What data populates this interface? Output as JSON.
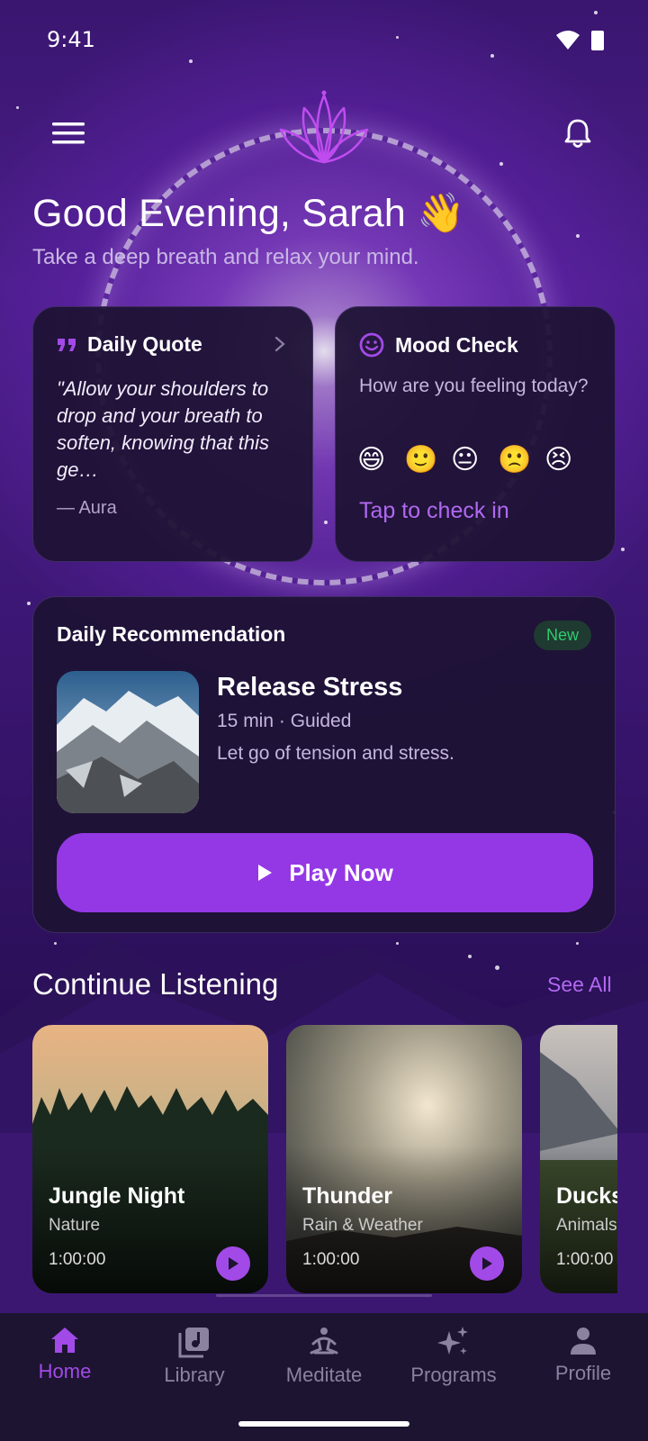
{
  "status_bar": {
    "time": "9:41"
  },
  "header": {
    "greeting": "Good Evening, Sarah 👋",
    "subtitle": "Take a deep breath and relax your mind."
  },
  "quote_card": {
    "title": "Daily Quote",
    "text": "\"Allow your shoulders to drop and your breath to soften, knowing that this ge…",
    "author": "— Aura"
  },
  "mood_card": {
    "title": "Mood Check",
    "question": "How are you feeling today?",
    "emojis": [
      "😄",
      "🙂",
      "😐",
      "🙁",
      "😣"
    ],
    "cta": "Tap to check in"
  },
  "recommendation": {
    "title": "Daily Recommendation",
    "badge": "New",
    "name": "Release Stress",
    "meta": "15 min · Guided",
    "description": "Let go of tension and stress.",
    "play_label": "Play Now"
  },
  "continue": {
    "title": "Continue Listening",
    "see_all": "See All",
    "items": [
      {
        "title": "Jungle Night",
        "category": "Nature",
        "duration": "1:00:00"
      },
      {
        "title": "Thunder",
        "category": "Rain & Weather",
        "duration": "1:00:00"
      },
      {
        "title": "Ducks",
        "category": "Animals",
        "duration": "1:00:00"
      }
    ]
  },
  "nav": {
    "items": [
      {
        "label": "Home",
        "icon": "home-icon",
        "active": true
      },
      {
        "label": "Library",
        "icon": "library-icon",
        "active": false
      },
      {
        "label": "Meditate",
        "icon": "meditate-icon",
        "active": false
      },
      {
        "label": "Programs",
        "icon": "sparkles-icon",
        "active": false
      },
      {
        "label": "Profile",
        "icon": "profile-icon",
        "active": false
      }
    ]
  },
  "colors": {
    "accent": "#9438e6",
    "accent_text": "#b069f0",
    "badge_green": "#2ecc71"
  }
}
